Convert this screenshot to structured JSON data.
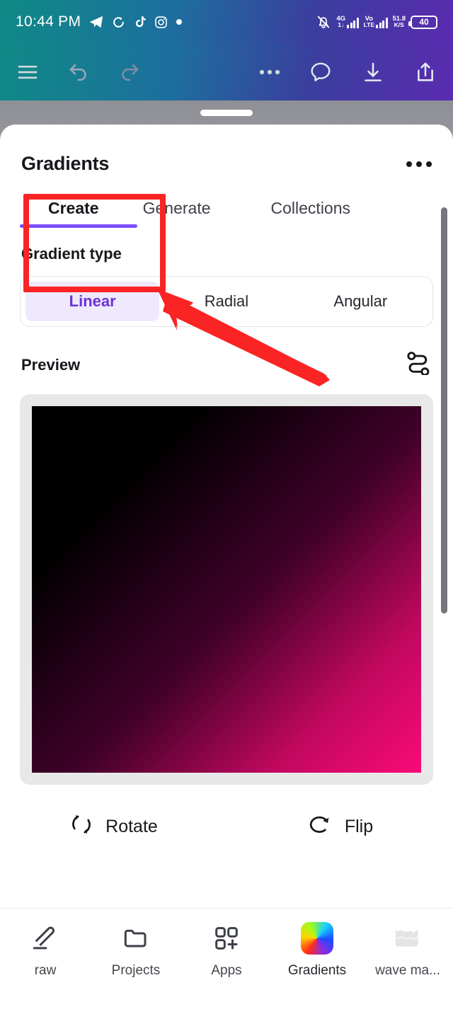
{
  "statusbar": {
    "time": "10:44 PM",
    "icons_left": [
      "telegram-icon",
      "sync-icon",
      "tiktok-icon",
      "instagram-icon",
      "dot-icon"
    ],
    "mute_icon": "bell-muted-icon",
    "network1_primary": "4G",
    "network1_secondary": "1↓",
    "network2_primary": "Vo",
    "network2_secondary": "LTE",
    "speed_value": "51.8",
    "speed_unit": "K/S",
    "battery": "40"
  },
  "toolbar": {
    "menu": "hamburger-menu-icon",
    "undo": "undo-icon",
    "redo": "redo-icon",
    "more": "more-horizontal-icon",
    "comment": "comment-icon",
    "download": "download-icon",
    "share": "share-icon"
  },
  "sheet": {
    "title": "Gradients",
    "kebab": "more-options-icon",
    "tabs": [
      {
        "label": "Create",
        "active": true
      },
      {
        "label": "Generate",
        "active": false
      },
      {
        "label": "Collections",
        "active": false
      }
    ],
    "gradient_type": {
      "label": "Gradient type",
      "options": [
        {
          "label": "Linear",
          "active": true
        },
        {
          "label": "Radial",
          "active": false
        },
        {
          "label": "Angular",
          "active": false
        }
      ]
    },
    "preview": {
      "label": "Preview",
      "settings_icon": "nodes-path-icon",
      "colors": [
        "#000000",
        "#fa0a78"
      ],
      "angle": "135deg"
    },
    "actions": [
      {
        "label": "Rotate",
        "icon": "rotate-icon"
      },
      {
        "label": "Flip",
        "icon": "flip-icon"
      }
    ]
  },
  "bottomnav": [
    {
      "label": "raw",
      "icon": "draw-pen-icon",
      "active": false
    },
    {
      "label": "Projects",
      "icon": "folder-icon",
      "active": false
    },
    {
      "label": "Apps",
      "icon": "apps-grid-icon",
      "active": false
    },
    {
      "label": "Gradients",
      "icon": "color-wheel-icon",
      "active": true
    },
    {
      "label": "wave ma...",
      "icon": "wave-icon",
      "active": false
    }
  ],
  "annotation": {
    "accent_color": "#fa2424",
    "box_target": "Create",
    "arrow": "pointer-arrow"
  },
  "theme": {
    "accent_purple": "#7c4dff",
    "segment_active_bg": "#efe9fd",
    "segment_active_text": "#6b32d6"
  }
}
